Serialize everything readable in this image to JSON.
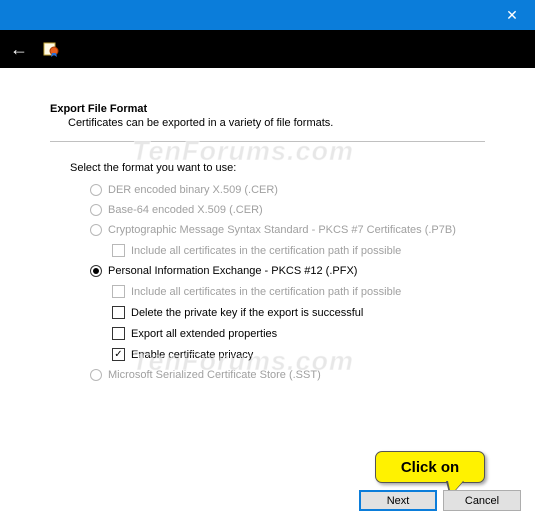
{
  "titlebar": {
    "close_glyph": "✕"
  },
  "navbar": {
    "back_glyph": "←"
  },
  "page": {
    "heading": "Export File Format",
    "subheading": "Certificates can be exported in a variety of file formats.",
    "prompt": "Select the format you want to use:"
  },
  "options": {
    "der": {
      "label": "DER encoded binary X.509 (.CER)"
    },
    "base64": {
      "label": "Base-64 encoded X.509 (.CER)"
    },
    "p7b": {
      "label": "Cryptographic Message Syntax Standard - PKCS #7 Certificates (.P7B)",
      "include_chain": "Include all certificates in the certification path if possible"
    },
    "pfx": {
      "label": "Personal Information Exchange - PKCS #12 (.PFX)",
      "include_chain": "Include all certificates in the certification path if possible",
      "delete_key": "Delete the private key if the export is successful",
      "export_extended": "Export all extended properties",
      "cert_privacy": "Enable certificate privacy"
    },
    "sst": {
      "label": "Microsoft Serialized Certificate Store (.SST)"
    }
  },
  "footer": {
    "next": "Next",
    "cancel": "Cancel"
  },
  "watermark": "TenForums.com",
  "callout": "Click on"
}
